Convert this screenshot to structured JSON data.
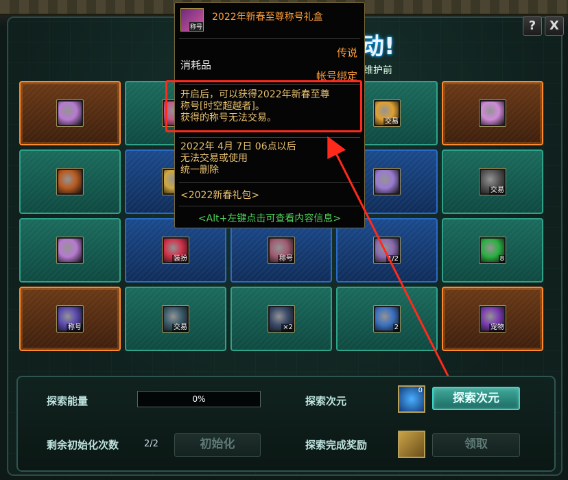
{
  "window": {
    "help_label": "?",
    "close_label": "X",
    "title_partial": "动!",
    "subtitle_partial": "维护前"
  },
  "tooltip": {
    "icon_tag": "称号",
    "title": "2022年新春至尊称号礼盒",
    "rarity": "传说",
    "category": "消耗品",
    "bind": "帐号绑定",
    "description": [
      "开启后，可以获得2022年新春至尊",
      "称号[时空超越者]。",
      "获得的称号无法交易。"
    ],
    "expire": [
      "2022年 4月 7日 06点以后",
      "无法交易或使用",
      "统一删除"
    ],
    "package": "<2022新春礼包>",
    "hint": "<Alt+左键点击可查看内容信息>"
  },
  "grid": {
    "cells": [
      {
        "name": "cell-1-1",
        "style": "orange",
        "art": "#b77ad0",
        "tag": ""
      },
      {
        "name": "cell-1-2",
        "style": "green",
        "art": "#c15a8a",
        "tag": ""
      },
      {
        "name": "cell-1-3",
        "style": "green",
        "art": "",
        "tag": ""
      },
      {
        "name": "cell-1-4",
        "style": "green",
        "art": "#e0a030",
        "tag": "交易"
      },
      {
        "name": "cell-1-5",
        "style": "orange",
        "art": "#d08ad8",
        "tag": ""
      },
      {
        "name": "cell-2-1",
        "style": "green",
        "art": "#b85a20",
        "tag": ""
      },
      {
        "name": "cell-2-2",
        "style": "blue",
        "art": "#d0a840",
        "tag": ""
      },
      {
        "name": "cell-2-3",
        "style": "blue",
        "art": "",
        "tag": ""
      },
      {
        "name": "cell-2-4",
        "style": "blue",
        "art": "#9a7ad0",
        "tag": ""
      },
      {
        "name": "cell-2-5",
        "style": "green",
        "art": "#555555",
        "tag": "交易"
      },
      {
        "name": "cell-3-1",
        "style": "green",
        "art": "#b77ad0",
        "tag": ""
      },
      {
        "name": "cell-3-2",
        "style": "blue",
        "art": "#d0304a",
        "tag": "装扮"
      },
      {
        "name": "cell-3-3",
        "style": "blue",
        "art": "#a05a70",
        "tag": "称号"
      },
      {
        "name": "cell-3-4",
        "style": "blue",
        "art": "#8a6ab0",
        "tag": "1/2"
      },
      {
        "name": "cell-3-5",
        "style": "green",
        "art": "#2ab040",
        "tag": "8"
      },
      {
        "name": "cell-4-1",
        "style": "orange",
        "art": "#5a4ab0",
        "tag": "称号"
      },
      {
        "name": "cell-4-2",
        "style": "green",
        "art": "#3a5a6a",
        "tag": "交易"
      },
      {
        "name": "cell-4-3",
        "style": "green",
        "art": "#3a4a6a",
        "tag": "×2"
      },
      {
        "name": "cell-4-4",
        "style": "green",
        "art": "#3a70c0",
        "tag": "2"
      },
      {
        "name": "cell-4-5",
        "style": "orange",
        "art": "#7a3ab0",
        "tag": "宠物"
      }
    ]
  },
  "bottom": {
    "energy_label": "探索能量",
    "energy_value": "0%",
    "energy_fraction": 0,
    "explore_label": "探索次元",
    "explore_slot_count": "0",
    "explore_button": "探索次元",
    "reset_label": "剩余初始化次数",
    "reset_count": "2/2",
    "reset_button": "初始化",
    "reward_label": "探索完成奖励",
    "reward_button": "领取"
  },
  "colors": {
    "highlight": "#ff2a1c",
    "tooltip_accent": "#ff9f3a",
    "tooltip_text": "#e8c070",
    "hint_text": "#4fd35c"
  }
}
